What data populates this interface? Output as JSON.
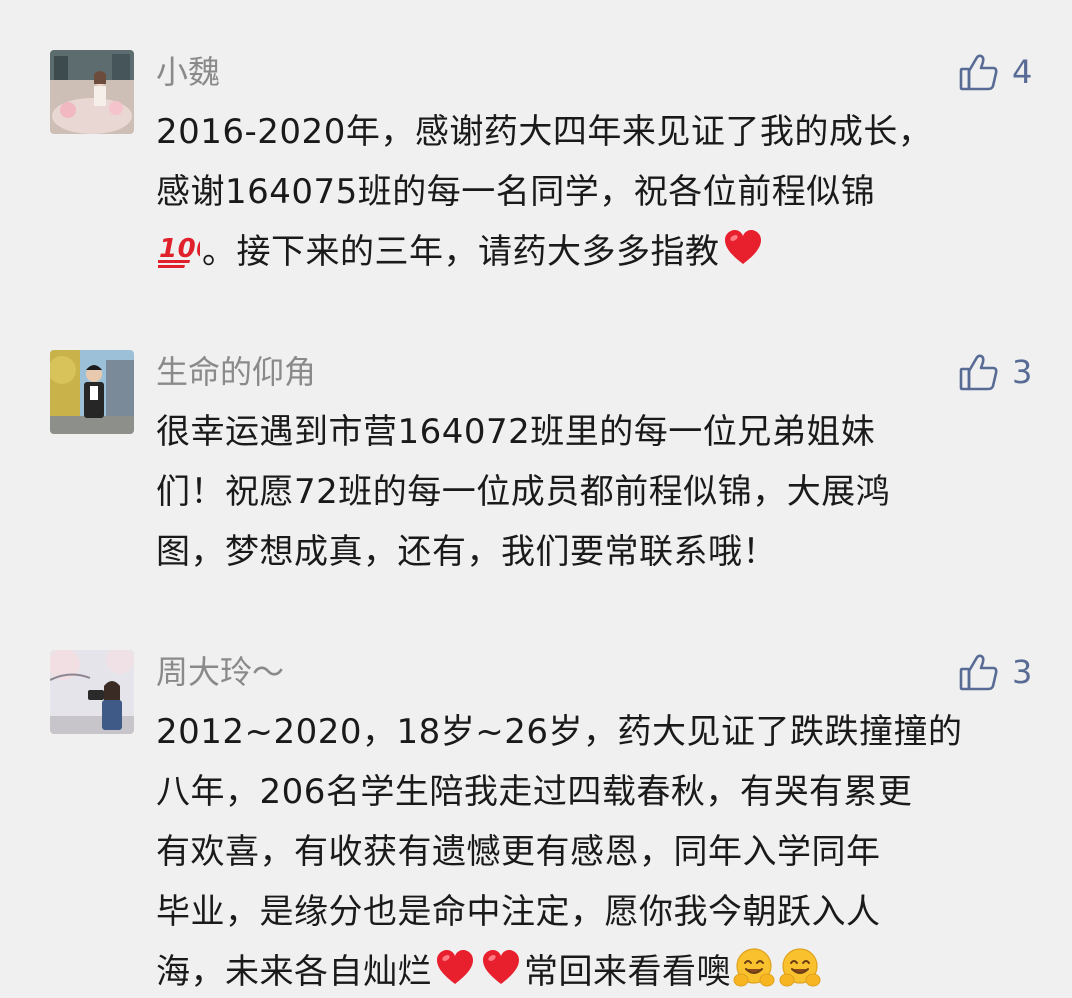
{
  "comments": [
    {
      "username": "小魏",
      "likes": "4",
      "lines": [
        "2016-2020年，感谢药大四年来见证了我的成长，",
        "感谢164075班的每一名同学，祝各位前程似锦",
        [
          "emoji:hundred-points",
          "。接下来的三年，请药大多多指教",
          "emoji:red-heart"
        ]
      ]
    },
    {
      "username": "生命的仰角",
      "likes": "3",
      "lines": [
        "很幸运遇到市营164072班里的每一位兄弟姐妹",
        "们！祝愿72班的每一位成员都前程似锦，大展鸿",
        "图，梦想成真，还有，我们要常联系哦！"
      ]
    },
    {
      "username": "周大玲～",
      "likes": "3",
      "lines": [
        "2012~2020，18岁~26岁，药大见证了跌跌撞撞的",
        "八年，206名学生陪我走过四载春秋，有哭有累更",
        "有欢喜，有收获有遗憾更有感恩，同年入学同年",
        "毕业，是缘分也是命中注定，愿你我今朝跃入人",
        [
          "海，未来各自灿烂",
          "emoji:red-heart",
          "emoji:red-heart",
          "常回来看看噢",
          "emoji:hugging-face",
          "emoji:hugging-face"
        ]
      ]
    }
  ],
  "colors": {
    "background": "#f0f0f0",
    "username": "#8a8a8a",
    "like_accent": "#576b95",
    "text": "#1a1a1a"
  },
  "icons": {
    "like": "thumbs-up-icon"
  }
}
